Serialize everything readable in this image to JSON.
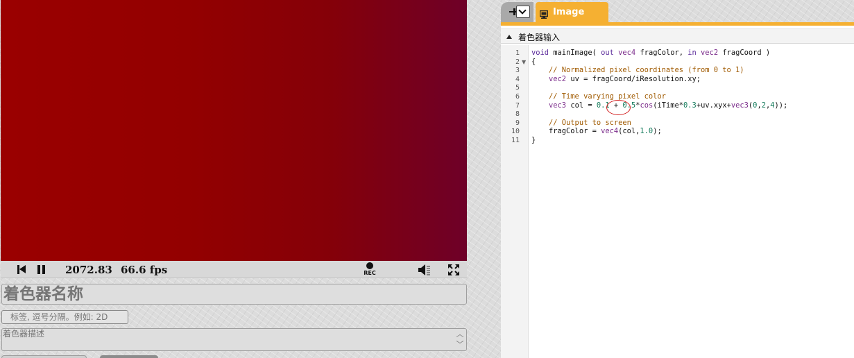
{
  "player": {
    "time": "2072.83",
    "fps": "66.6 fps",
    "rec_label": "REC"
  },
  "form": {
    "shader_name": "着色器名称",
    "tags_placeholder": "标签, 逗号分隔。例如: 2D",
    "description_placeholder": "着色器描述"
  },
  "editor": {
    "tab_label": "Image",
    "section_title": "着色器输入",
    "line_numbers": [
      "1",
      "2",
      "3",
      "4",
      "5",
      "6",
      "7",
      "8",
      "9",
      "10",
      "11"
    ],
    "lines": [
      [
        {
          "t": "void",
          "c": "kw"
        },
        {
          "t": " mainImage( ",
          "c": ""
        },
        {
          "t": "out",
          "c": "kw"
        },
        {
          "t": " ",
          "c": ""
        },
        {
          "t": "vec4",
          "c": "ty"
        },
        {
          "t": " fragColor, ",
          "c": ""
        },
        {
          "t": "in",
          "c": "kw"
        },
        {
          "t": " ",
          "c": ""
        },
        {
          "t": "vec2",
          "c": "ty"
        },
        {
          "t": " fragCoord )",
          "c": ""
        }
      ],
      [
        {
          "t": "{",
          "c": ""
        }
      ],
      [
        {
          "t": "    // Normalized pixel coordinates (from 0 to 1)",
          "c": "cm"
        }
      ],
      [
        {
          "t": "    ",
          "c": ""
        },
        {
          "t": "vec2",
          "c": "ty"
        },
        {
          "t": " uv = fragCoord/iResolution.xy;",
          "c": ""
        }
      ],
      [
        {
          "t": "",
          "c": ""
        }
      ],
      [
        {
          "t": "    // Time varying pixel color",
          "c": "cm"
        }
      ],
      [
        {
          "t": "    ",
          "c": ""
        },
        {
          "t": "vec3",
          "c": "ty"
        },
        {
          "t": " col = ",
          "c": ""
        },
        {
          "t": "0.1",
          "c": "num"
        },
        {
          "t": " + ",
          "c": ""
        },
        {
          "t": "0.5",
          "c": "num"
        },
        {
          "t": "*",
          "c": ""
        },
        {
          "t": "cos",
          "c": "fn"
        },
        {
          "t": "(iTime*",
          "c": ""
        },
        {
          "t": "0.3",
          "c": "num"
        },
        {
          "t": "+uv.xyx+",
          "c": ""
        },
        {
          "t": "vec3",
          "c": "ty"
        },
        {
          "t": "(",
          "c": ""
        },
        {
          "t": "0",
          "c": "num"
        },
        {
          "t": ",",
          "c": ""
        },
        {
          "t": "2",
          "c": "num"
        },
        {
          "t": ",",
          "c": ""
        },
        {
          "t": "4",
          "c": "num"
        },
        {
          "t": "));",
          "c": ""
        }
      ],
      [
        {
          "t": "",
          "c": ""
        }
      ],
      [
        {
          "t": "    // Output to screen",
          "c": "cm"
        }
      ],
      [
        {
          "t": "    fragColor = ",
          "c": ""
        },
        {
          "t": "vec4",
          "c": "ty"
        },
        {
          "t": "(col,",
          "c": ""
        },
        {
          "t": "1.0",
          "c": "num"
        },
        {
          "t": ");",
          "c": ""
        }
      ],
      [
        {
          "t": "}",
          "c": ""
        }
      ]
    ]
  },
  "icons": {
    "rewind": "rewind-icon",
    "pause": "pause-icon",
    "record": "record-icon",
    "volume": "volume-icon",
    "fullscreen": "fullscreen-icon",
    "add": "add-tab-icon",
    "dropdown": "chevron-down-icon",
    "monitor": "monitor-icon",
    "collapse": "collapse-triangle-icon"
  },
  "colors": {
    "accent": "#f5b032",
    "viewport_left": "#9a0000",
    "viewport_right": "#6e0028",
    "annotation": "#d21e1e"
  }
}
